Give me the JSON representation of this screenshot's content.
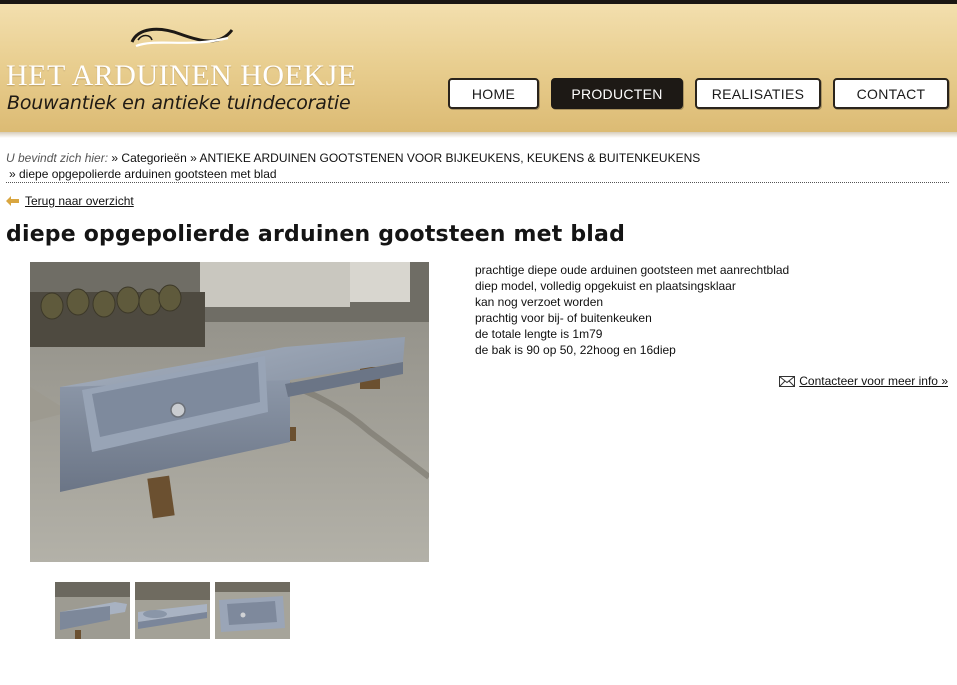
{
  "header": {
    "logo_title": "HET ARDUINEN HOEKJE",
    "logo_subtitle": "Bouwantiek en antieke tuindecoratie",
    "nav": [
      {
        "label": "HOME",
        "active": false
      },
      {
        "label": "PRODUCTEN",
        "active": true
      },
      {
        "label": "REALISATIES",
        "active": false
      },
      {
        "label": "CONTACT",
        "active": false
      }
    ]
  },
  "breadcrumb": {
    "prefix": "U bevindt zich hier:",
    "items": [
      "» Categorieën",
      "» ANTIEKE ARDUINEN GOOTSTENEN VOOR BIJKEUKENS, KEUKENS & BUITENKEUKENS",
      "» diepe opgepolierde arduinen gootsteen met blad"
    ]
  },
  "back_link": "Terug naar overzicht",
  "product": {
    "title": "diepe opgepolierde arduinen gootsteen met blad",
    "description": [
      "prachtige diepe oude arduinen gootsteen met aanrechtblad",
      "diep model, volledig opgekuist en plaatsingsklaar",
      "kan nog verzoet worden",
      "prachtig voor bij- of buitenkeuken",
      "de totale lengte is 1m79",
      "de bak is 90 op 50, 22hoog en 16diep"
    ],
    "contact_link": "Contacteer voor meer info »",
    "thumbnail_count": 3
  },
  "colors": {
    "header_light": "#f3dfae",
    "header_dark": "#dcbb74",
    "nav_active": "#1d1915",
    "stone": "#8f9aab"
  },
  "icons": [
    "swash-ornament-icon",
    "back-arrow-icon",
    "envelope-icon"
  ]
}
